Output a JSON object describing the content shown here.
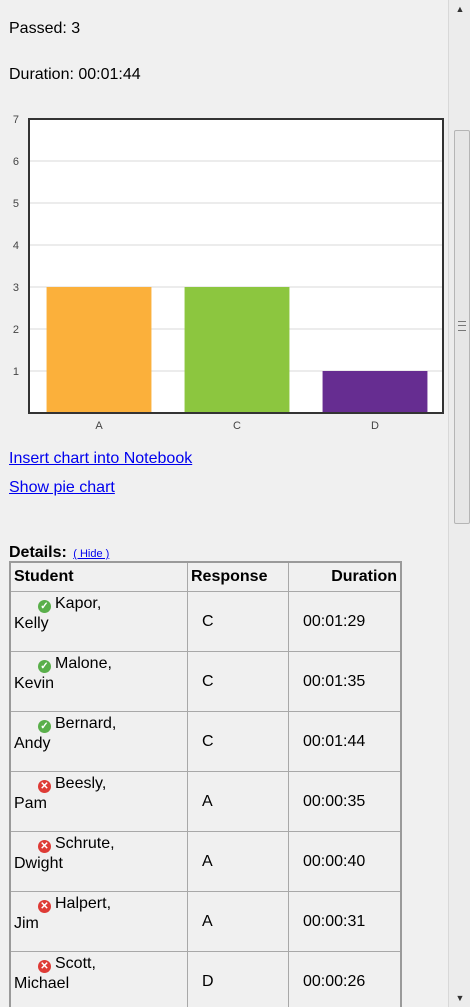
{
  "summary": {
    "passed_text": "Passed: 3",
    "duration_text": "Duration: 00:01:44"
  },
  "chart_data": {
    "type": "bar",
    "categories": [
      "A",
      "C",
      "D"
    ],
    "values": [
      3,
      3,
      1
    ],
    "colors": [
      "#fbb03b",
      "#8cc63f",
      "#662d91"
    ],
    "ylim": [
      0,
      7
    ],
    "yticks": [
      1,
      2,
      3,
      4,
      5,
      6,
      7
    ],
    "title": "",
    "xlabel": "",
    "ylabel": "",
    "grid": true
  },
  "links": {
    "insert_chart": "Insert chart into Notebook",
    "show_pie": "Show pie chart"
  },
  "details": {
    "label": "Details:",
    "hide_link": "( Hide )",
    "columns": [
      "Student",
      "Response",
      "Duration"
    ],
    "rows": [
      {
        "status": "passed",
        "first": "Kapor,",
        "last": "Kelly",
        "response": "C",
        "duration": "00:01:29"
      },
      {
        "status": "passed",
        "first": "Malone,",
        "last": "Kevin",
        "response": "C",
        "duration": "00:01:35"
      },
      {
        "status": "passed",
        "first": "Bernard,",
        "last": "Andy",
        "response": "C",
        "duration": "00:01:44"
      },
      {
        "status": "failed",
        "first": "Beesly,",
        "last": "Pam",
        "response": "A",
        "duration": "00:00:35"
      },
      {
        "status": "failed",
        "first": "Schrute,",
        "last": "Dwight",
        "response": "A",
        "duration": "00:00:40"
      },
      {
        "status": "failed",
        "first": "Halpert,",
        "last": "Jim",
        "response": "A",
        "duration": "00:00:31"
      },
      {
        "status": "failed",
        "first": "Scott,",
        "last": "Michael",
        "response": "D",
        "duration": "00:00:26"
      }
    ]
  },
  "icons": {
    "passed": "check-circle-icon",
    "failed": "x-circle-icon",
    "scroll_up": "arrow-up-icon",
    "scroll_down": "arrow-down-icon"
  }
}
